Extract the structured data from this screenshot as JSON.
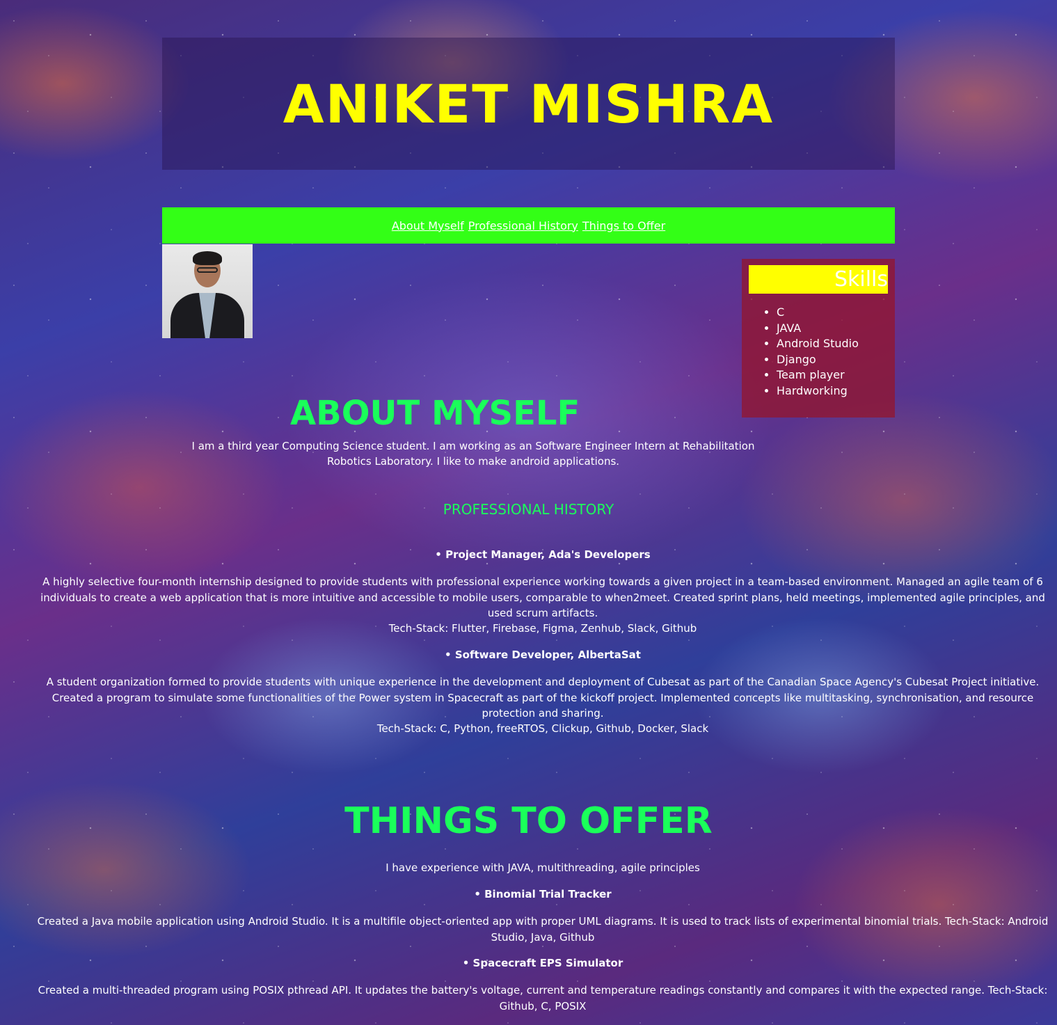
{
  "header": {
    "name": "ANIKET MISHRA"
  },
  "nav": {
    "links": [
      "About Myself",
      "Professional History",
      "Things to Offer"
    ]
  },
  "skills": {
    "title": "Skills",
    "items": [
      "C",
      "JAVA",
      "Android Studio",
      "Django",
      "Team player",
      "Hardworking"
    ]
  },
  "about": {
    "heading": "ABOUT MYSELF",
    "text": "I am a third year Computing Science student. I am working as an Software Engineer Intern at Rehabilitation Robotics Laboratory. I like to make android applications."
  },
  "professional": {
    "heading": "PROFESSIONAL HISTORY",
    "jobs": [
      {
        "title": "• Project Manager, Ada's Developers",
        "description": "A highly selective four-month internship designed to provide students with professional experience working towards a given project in a team-based environment. Managed an agile team of 6 individuals to create a web application that is more intuitive and accessible to mobile users, comparable to when2meet. Created sprint plans, held meetings, implemented agile principles, and used scrum artifacts.",
        "tech": "Tech-Stack: Flutter, Firebase, Figma, Zenhub, Slack, Github"
      },
      {
        "title": "• Software Developer, AlbertaSat",
        "description": "A student organization formed to provide students with unique experience in the development and deployment of Cubesat as part of the Canadian Space Agency's Cubesat Project initiative. Created a program to simulate some functionalities of the Power system in Spacecraft as part of the kickoff project. Implemented concepts like multitasking, synchronisation, and resource protection and sharing.",
        "tech": "Tech-Stack: C, Python, freeRTOS, Clickup, Github, Docker, Slack"
      }
    ]
  },
  "offer": {
    "heading": "THINGS TO OFFER",
    "intro": "I have experience with JAVA, multithreading, agile principles",
    "projects": [
      {
        "title": "• Binomial Trial Tracker",
        "description": "Created a Java mobile application using Android Studio. It is a multifile object-oriented app with proper UML diagrams. It is used to track lists of experimental binomial trials. Tech-Stack: Android Studio, Java, Github"
      },
      {
        "title": "• Spacecraft EPS Simulator",
        "description": "Created a multi-threaded program using POSIX pthread API. It updates the battery's voltage, current and temperature readings constantly and compares it with the expected range. Tech-Stack: Github, C, POSIX"
      }
    ]
  },
  "colors": {
    "name": "#ffff00",
    "nav_bg": "#33ff16",
    "heading": "#1aff5a",
    "skills_bg": "#96142880"
  }
}
